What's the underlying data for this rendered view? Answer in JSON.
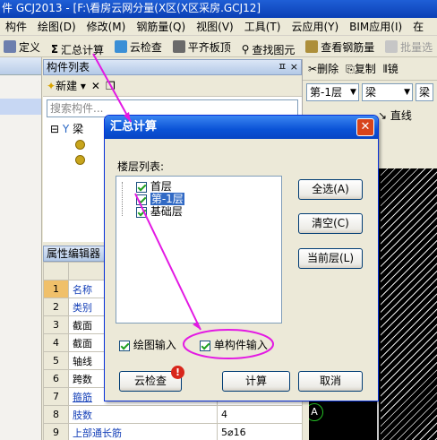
{
  "window": {
    "title": "件 GCJ2013 - [F:\\看房云网分量(X区(X区采房.GCJ12]"
  },
  "menu": [
    "构件",
    "绘图(D)",
    "修改(M)",
    "钢筋量(Q)",
    "视图(V)",
    "工具(T)",
    "云应用(Y)",
    "BIM应用(I)",
    "在"
  ],
  "toolbar": {
    "define": "定义",
    "summary": "汇总计算",
    "cloud_check": "云检查",
    "level_slab": "平齐板顶",
    "find_element": "查找图元",
    "view_rebar": "查看钢筋量",
    "batch_select": "批量选"
  },
  "component_list": {
    "header": "构件列表",
    "pin": "ㅍ ×",
    "new_button": "新建",
    "search_placeholder": "搜索构件...",
    "tree": {
      "root": "梁",
      "children": [
        "",
        ""
      ]
    }
  },
  "property_editor": {
    "header": "属性编辑器",
    "column": "属",
    "rows": [
      {
        "num": "1",
        "name": "名称",
        "value": ""
      },
      {
        "num": "2",
        "name": "类别",
        "value": ""
      },
      {
        "num": "3",
        "name": "截面",
        "value": ""
      },
      {
        "num": "4",
        "name": "截面",
        "value": ""
      },
      {
        "num": "5",
        "name": "轴线",
        "value": ""
      },
      {
        "num": "6",
        "name": "跨数",
        "value": ""
      },
      {
        "num": "7",
        "name": "箍筋",
        "value": ""
      },
      {
        "num": "8",
        "name": "肢数",
        "value": "4"
      },
      {
        "num": "9",
        "name": "上部通长筋",
        "value": "5⌀16"
      }
    ]
  },
  "right_panel": {
    "delete": "删除",
    "copy": "复制",
    "mirror": "镜",
    "floor": "第-1层",
    "type": "梁",
    "type2": "梁",
    "line": "直线",
    "axis_label": "A"
  },
  "dialog": {
    "title": "汇总计算",
    "floor_list_label": "楼层列表:",
    "floors": [
      {
        "label": "首层",
        "checked": true,
        "selected": false
      },
      {
        "label": "第-1层",
        "checked": true,
        "selected": true
      },
      {
        "label": "基础层",
        "checked": true,
        "selected": false
      }
    ],
    "select_all": "全选(A)",
    "clear": "清空(C)",
    "current_floor": "当前层(L)",
    "draw_input": "绘图输入",
    "single_input": "单构件输入",
    "cloud_check": "云检查",
    "calculate": "计算",
    "cancel": "取消"
  },
  "colors": {
    "annotation": "#e319e3",
    "title_blue": "#0a52d6"
  }
}
